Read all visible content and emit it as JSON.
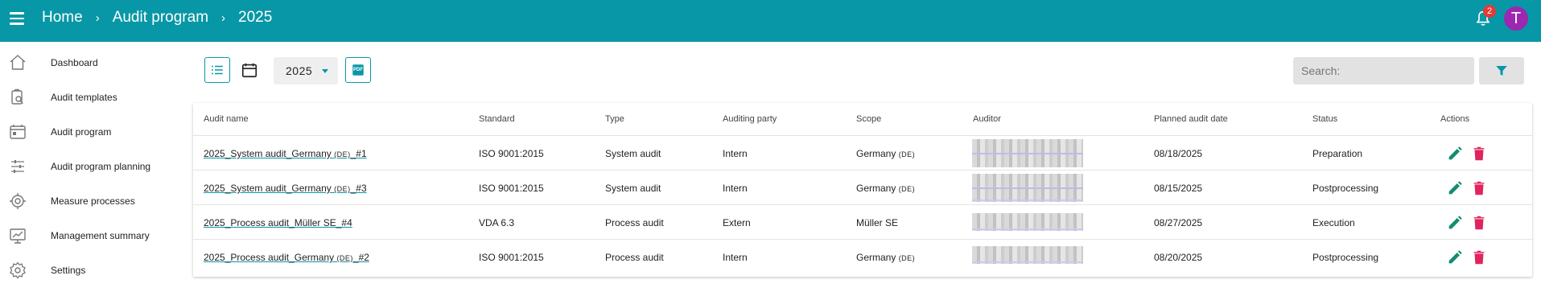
{
  "header": {
    "breadcrumb": [
      "Home",
      "Audit program",
      "2025"
    ],
    "notifications_count": "2",
    "avatar_initial": "T",
    "brand_color": "#0897a6"
  },
  "sidebar": {
    "items": [
      {
        "label": "Dashboard",
        "icon": "home-icon"
      },
      {
        "label": "Audit templates",
        "icon": "clipboard-search-icon"
      },
      {
        "label": "Audit program",
        "icon": "calendar-program-icon"
      },
      {
        "label": "Audit program planning",
        "icon": "tune-icon"
      },
      {
        "label": "Measure processes",
        "icon": "target-icon"
      },
      {
        "label": "Management summary",
        "icon": "monitor-chart-icon"
      },
      {
        "label": "Settings",
        "icon": "gear-icon"
      }
    ]
  },
  "toolbar": {
    "year": "2025",
    "pdf_label": "PDF",
    "search_placeholder": "Search:"
  },
  "table": {
    "columns": [
      "Audit name",
      "Standard",
      "Type",
      "Auditing party",
      "Scope",
      "Auditor",
      "Planned audit date",
      "Status",
      "Actions"
    ],
    "rows": [
      {
        "name_pre": "2025_System audit_Germany ",
        "name_cc": "(DE)",
        "name_post": "_#1",
        "standard": "ISO 9001:2015",
        "type": "System audit",
        "party": "Intern",
        "scope": "Germany ",
        "scope_cc": "(DE)",
        "date": "08/18/2025",
        "status": "Preparation"
      },
      {
        "name_pre": "2025_System audit_Germany ",
        "name_cc": "(DE)",
        "name_post": "_#3",
        "standard": "ISO 9001:2015",
        "type": "System audit",
        "party": "Intern",
        "scope": "Germany ",
        "scope_cc": "(DE)",
        "date": "08/15/2025",
        "status": "Postprocessing"
      },
      {
        "name_pre": "2025_Process audit_Müller SE_#4",
        "name_cc": "",
        "name_post": "",
        "standard": "VDA 6.3",
        "type": "Process audit",
        "party": "Extern",
        "scope": "Müller SE",
        "scope_cc": "",
        "date": "08/27/2025",
        "status": "Execution"
      },
      {
        "name_pre": "2025_Process audit_Germany ",
        "name_cc": "(DE)",
        "name_post": "_#2",
        "standard": "ISO 9001:2015",
        "type": "Process audit",
        "party": "Intern",
        "scope": "Germany ",
        "scope_cc": "(DE)",
        "date": "08/20/2025",
        "status": "Postprocessing"
      }
    ]
  },
  "colors": {
    "edit": "#128c6f",
    "delete": "#e0245e"
  }
}
